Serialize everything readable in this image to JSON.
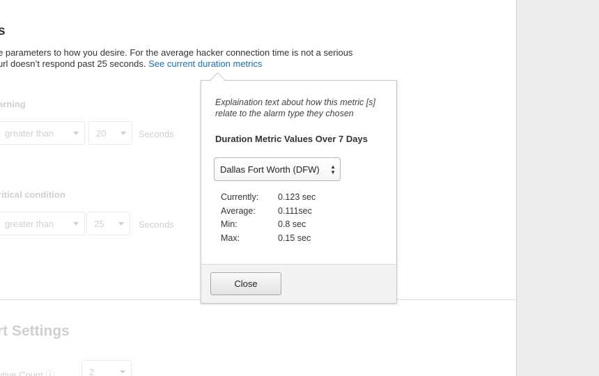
{
  "page": {
    "heading": "s",
    "intro_line1": "e parameters to how you desire. For the average hacker connection time is not a serious",
    "intro_line2": "url doesn’t respond past 25 seconds.",
    "intro_link": "See current duration metrics"
  },
  "warning": {
    "label": "arning",
    "operator": "greater than",
    "value": "20",
    "unit": "Seconds"
  },
  "critical": {
    "label": "ritical condition",
    "operator": "greater than",
    "value": "25",
    "unit": "Seconds"
  },
  "settings": {
    "heading": "rt Settings",
    "count_label": "utive Count",
    "count_value": "2"
  },
  "popover": {
    "description": "Explaination text about how this metric [s] relate to the alarm type they chosen",
    "title": "Duration Metric Values Over 7 Days",
    "region_selected": "Dallas Fort Worth (DFW)",
    "metrics": [
      {
        "label": "Currently:",
        "value": "0.123 sec"
      },
      {
        "label": "Average:",
        "value": "0.111sec"
      },
      {
        "label": "Min:",
        "value": "0.8 sec"
      },
      {
        "label": "Max:",
        "value": "0.15 sec"
      }
    ],
    "close_label": "Close"
  }
}
